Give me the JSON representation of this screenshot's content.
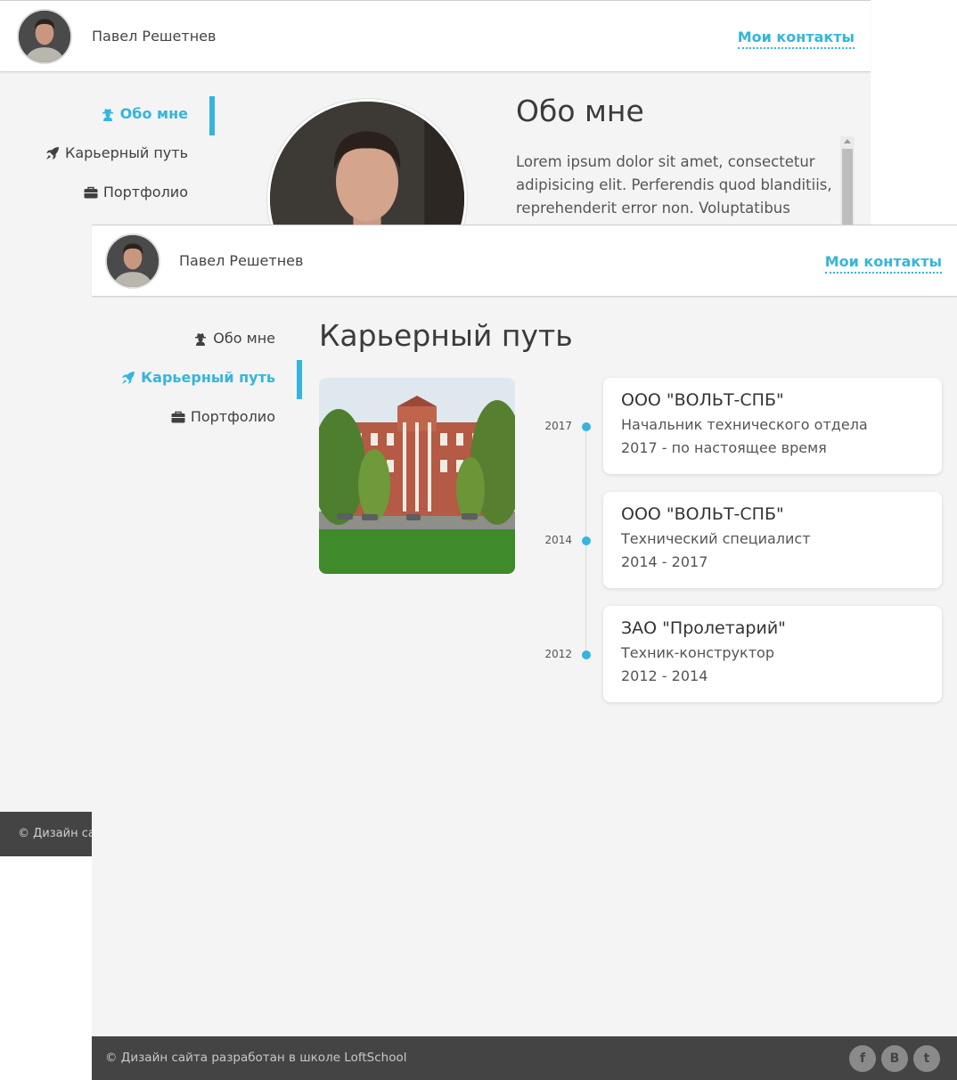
{
  "back_window": {
    "header": {
      "user_name": "Павел Решетнев",
      "contacts_link": "Мои контакты"
    },
    "nav": {
      "items": [
        {
          "label": "Обо мне",
          "icon": "user-secret-icon",
          "active": true
        },
        {
          "label": "Карьерный путь",
          "icon": "rocket-icon",
          "active": false
        },
        {
          "label": "Портфолио",
          "icon": "briefcase-icon",
          "active": false
        }
      ]
    },
    "about": {
      "title": "Обо мне",
      "text": "Lorem ipsum dolor sit amet, consectetur adipisicing elit. Perferendis quod blanditiis, reprehenderit error non. Voluptatibus"
    },
    "footer_text": "© Дизайн сайта разработан в школе LoftSchool"
  },
  "front_window": {
    "header": {
      "user_name": "Павел Решетнев",
      "contacts_link": "Мои контакты"
    },
    "nav": {
      "items": [
        {
          "label": "Обо мне",
          "icon": "user-secret-icon",
          "active": false
        },
        {
          "label": "Карьерный путь",
          "icon": "rocket-icon",
          "active": true
        },
        {
          "label": "Портфолио",
          "icon": "briefcase-icon",
          "active": false
        }
      ]
    },
    "career": {
      "title": "Карьерный путь",
      "jobs": [
        {
          "year": "2017",
          "company": "ООО \"ВОЛЬТ-СПБ\"",
          "position": "Начальник технического отдела",
          "period": "2017 - по настоящее время"
        },
        {
          "year": "2014",
          "company": "ООО \"ВОЛЬТ-СПБ\"",
          "position": "Технический специалист",
          "period": "2014 - 2017"
        },
        {
          "year": "2012",
          "company": "ЗАО \"Пролетарий\"",
          "position": "Техник-конструктор",
          "period": "2012 - 2014"
        }
      ]
    },
    "footer": {
      "text": "© Дизайн сайта разработан в школе LoftSchool",
      "social": [
        {
          "label": "f",
          "icon": "facebook-icon"
        },
        {
          "label": "В",
          "icon": "vk-icon"
        },
        {
          "label": "t",
          "icon": "twitter-icon"
        }
      ]
    }
  },
  "colors": {
    "accent": "#35b5dd",
    "background": "#f4f4f4",
    "footer": "#444444"
  }
}
